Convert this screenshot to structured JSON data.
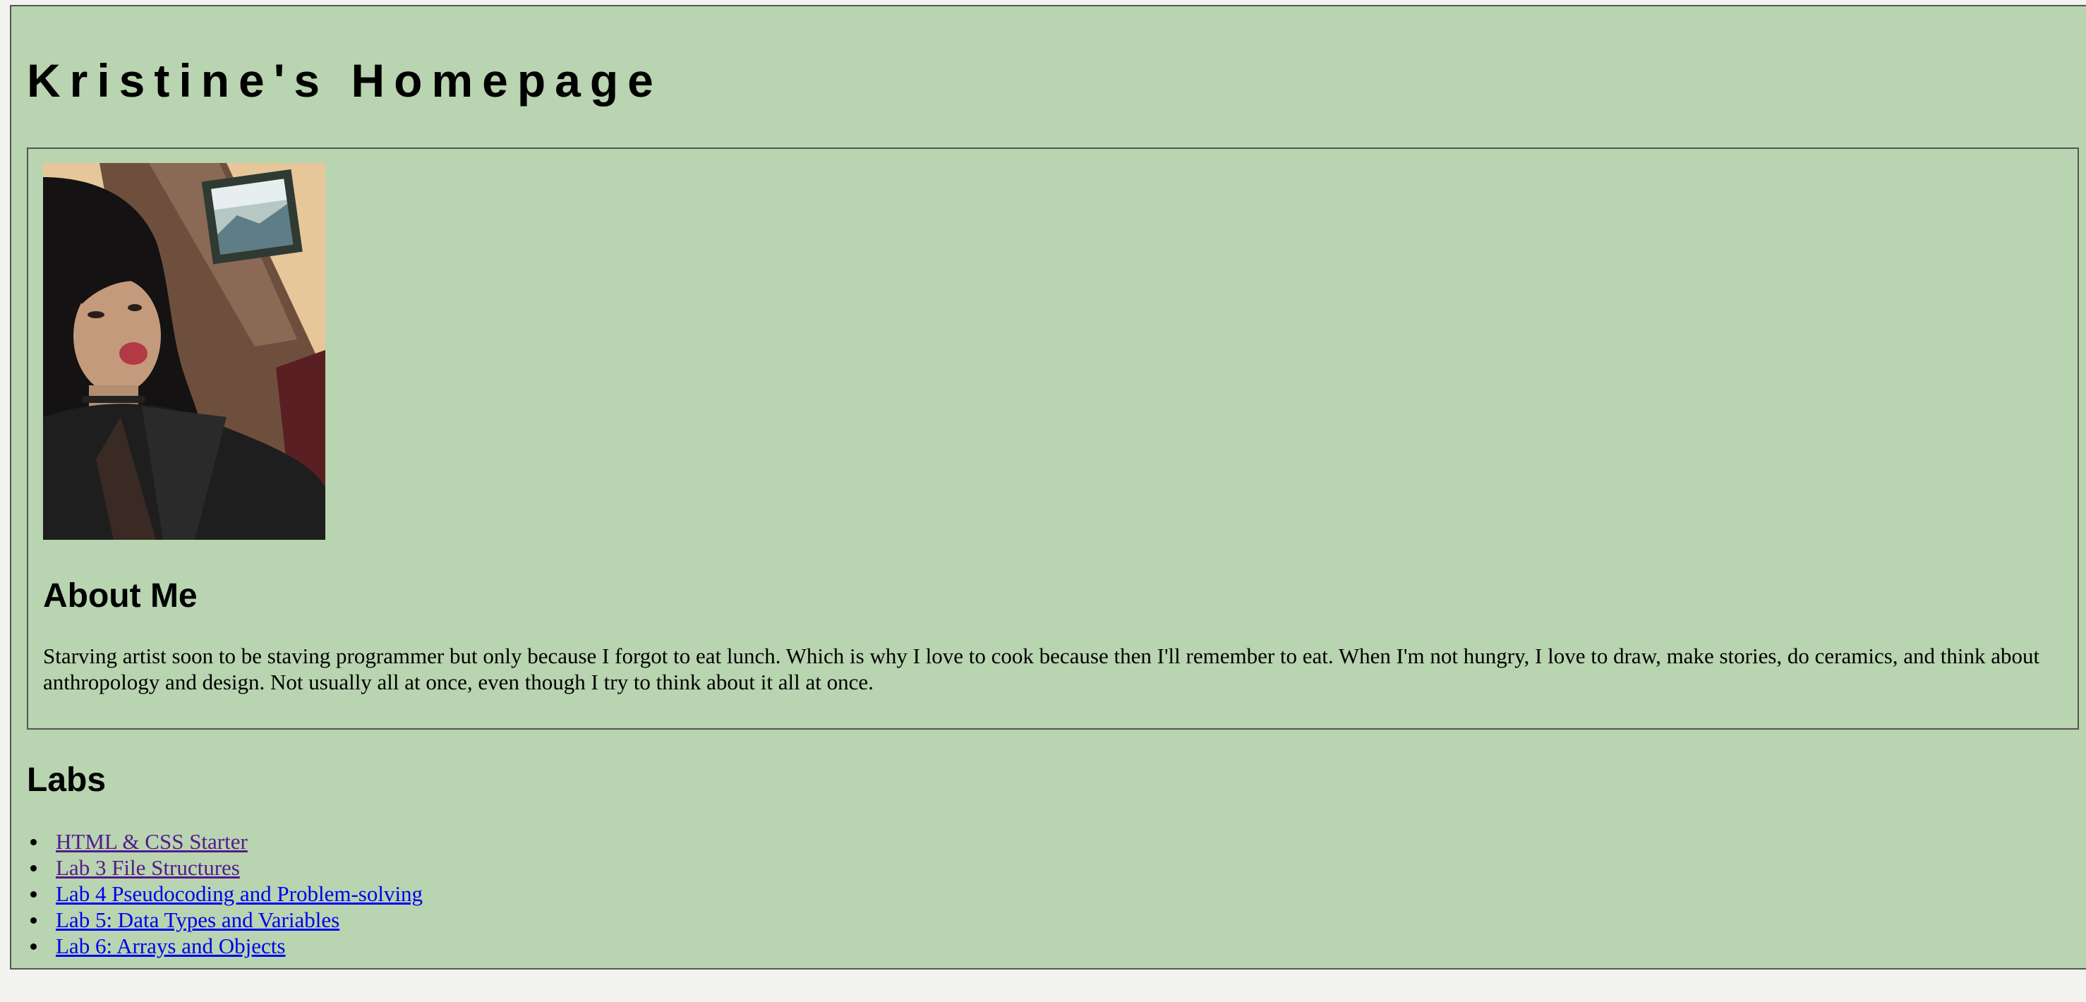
{
  "site": {
    "title": "Kristine's Homepage"
  },
  "about": {
    "heading": "About Me",
    "text": "Starving artist soon to be staving programmer but only because I forgot to eat lunch. Which is why I love to cook because then I'll remember to eat. When I'm not hungry, I love to draw, make stories, do ceramics, and think about anthropology and design. Not usually all at once, even though I try to think about it all at once."
  },
  "labs": {
    "heading": "Labs",
    "items": [
      {
        "label": "HTML & CSS Starter",
        "visited": true
      },
      {
        "label": "Lab 3 File Structures",
        "visited": true
      },
      {
        "label": "Lab 4 Pseudocoding and Problem-solving",
        "visited": false
      },
      {
        "label": "Lab 5: Data Types and Variables",
        "visited": false
      },
      {
        "label": "Lab 6: Arrays and Objects",
        "visited": false
      }
    ]
  },
  "colors": {
    "page_background": "#b8d4b0",
    "border": "#555555",
    "visited_link": "#551a8b",
    "unvisited_link": "#0000ee"
  }
}
